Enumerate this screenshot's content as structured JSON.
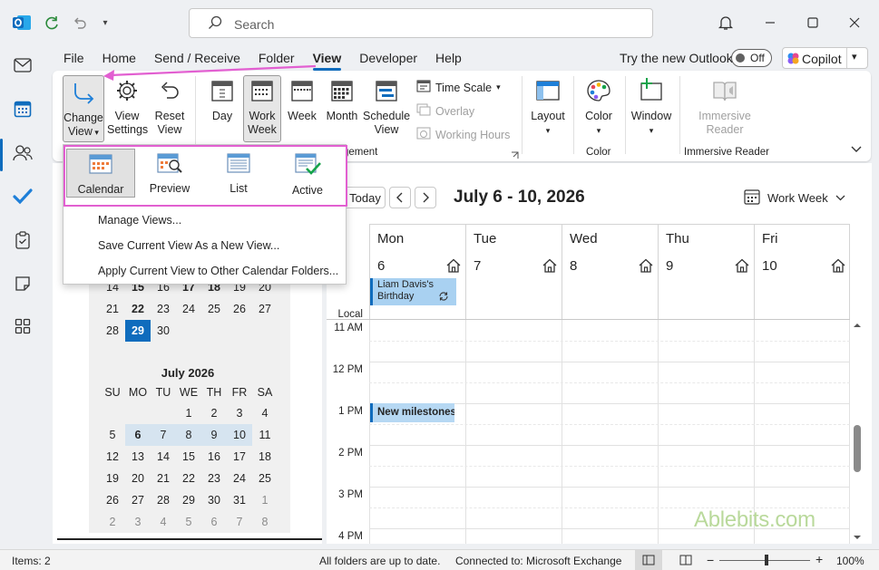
{
  "titlebar": {
    "search_placeholder": "Search"
  },
  "tabs": [
    "File",
    "Home",
    "Send / Receive",
    "Folder",
    "View",
    "Developer",
    "Help"
  ],
  "try_new": {
    "label": "Try the new Outlook",
    "toggle_state": "Off"
  },
  "copilot": {
    "label": "Copilot"
  },
  "ribbon": {
    "change_view": "Change View",
    "view_settings": "View Settings",
    "reset_view": "Reset View",
    "day": "Day",
    "work_week": "Work Week",
    "week": "Week",
    "month": "Month",
    "schedule_view": "Schedule View",
    "time_scale": "Time Scale",
    "overlay": "Overlay",
    "working_hours": "Working Hours",
    "arrangement_group": "gement",
    "layout": "Layout",
    "color": "Color",
    "color_group": "Color",
    "window": "Window",
    "immersive_reader": "Immersive Reader",
    "immersive_reader_group": "Immersive Reader"
  },
  "dropdown": {
    "views": [
      {
        "label": "Calendar",
        "selected": true
      },
      {
        "label": "Preview",
        "selected": false
      },
      {
        "label": "List",
        "selected": false
      },
      {
        "label": "Active",
        "selected": false
      }
    ],
    "manage_views": "Manage Views...",
    "save_view": "Save Current View As a New View...",
    "apply_view": "Apply Current View to Other Calendar Folders..."
  },
  "june_tail": {
    "rows": [
      [
        "14",
        "15",
        "16",
        "17",
        "18",
        "19",
        "20"
      ],
      [
        "21",
        "22",
        "23",
        "24",
        "25",
        "26",
        "27"
      ],
      [
        "28",
        "29",
        "30",
        "",
        "",
        "",
        ""
      ]
    ]
  },
  "july": {
    "title": "July 2026",
    "weekdays": [
      "SU",
      "MO",
      "TU",
      "WE",
      "TH",
      "FR",
      "SA"
    ],
    "rows": [
      [
        "",
        "",
        "",
        "1",
        "2",
        "3",
        "4"
      ],
      [
        "5",
        "6",
        "7",
        "8",
        "9",
        "10",
        "11"
      ],
      [
        "12",
        "13",
        "14",
        "15",
        "16",
        "17",
        "18"
      ],
      [
        "19",
        "20",
        "21",
        "22",
        "23",
        "24",
        "25"
      ],
      [
        "26",
        "27",
        "28",
        "29",
        "30",
        "31",
        "1"
      ],
      [
        "2",
        "3",
        "4",
        "5",
        "6",
        "7",
        "8"
      ]
    ]
  },
  "calendar": {
    "today_label": "Today",
    "range_title": "July 6 - 10, 2026",
    "view_selector": "Work Week",
    "timezone_label": "Local",
    "days": [
      {
        "name": "Mon",
        "num": "6"
      },
      {
        "name": "Tue",
        "num": "7"
      },
      {
        "name": "Wed",
        "num": "8"
      },
      {
        "name": "Thu",
        "num": "9"
      },
      {
        "name": "Fri",
        "num": "10"
      }
    ],
    "times": [
      "11 AM",
      "12 PM",
      "1 PM",
      "2 PM",
      "3 PM",
      "4 PM"
    ],
    "events": {
      "birthday": "Liam Davis's Birthday",
      "milestone": "New milestones"
    }
  },
  "status": {
    "items": "Items: 2",
    "folders": "All folders are up to date.",
    "connected": "Connected to: Microsoft Exchange",
    "zoom": "100%"
  },
  "watermark": "Ablebits.com",
  "colors": {
    "accent": "#0f6cbd",
    "highlight": "#e25fd1",
    "event": "#a9d1f1"
  }
}
